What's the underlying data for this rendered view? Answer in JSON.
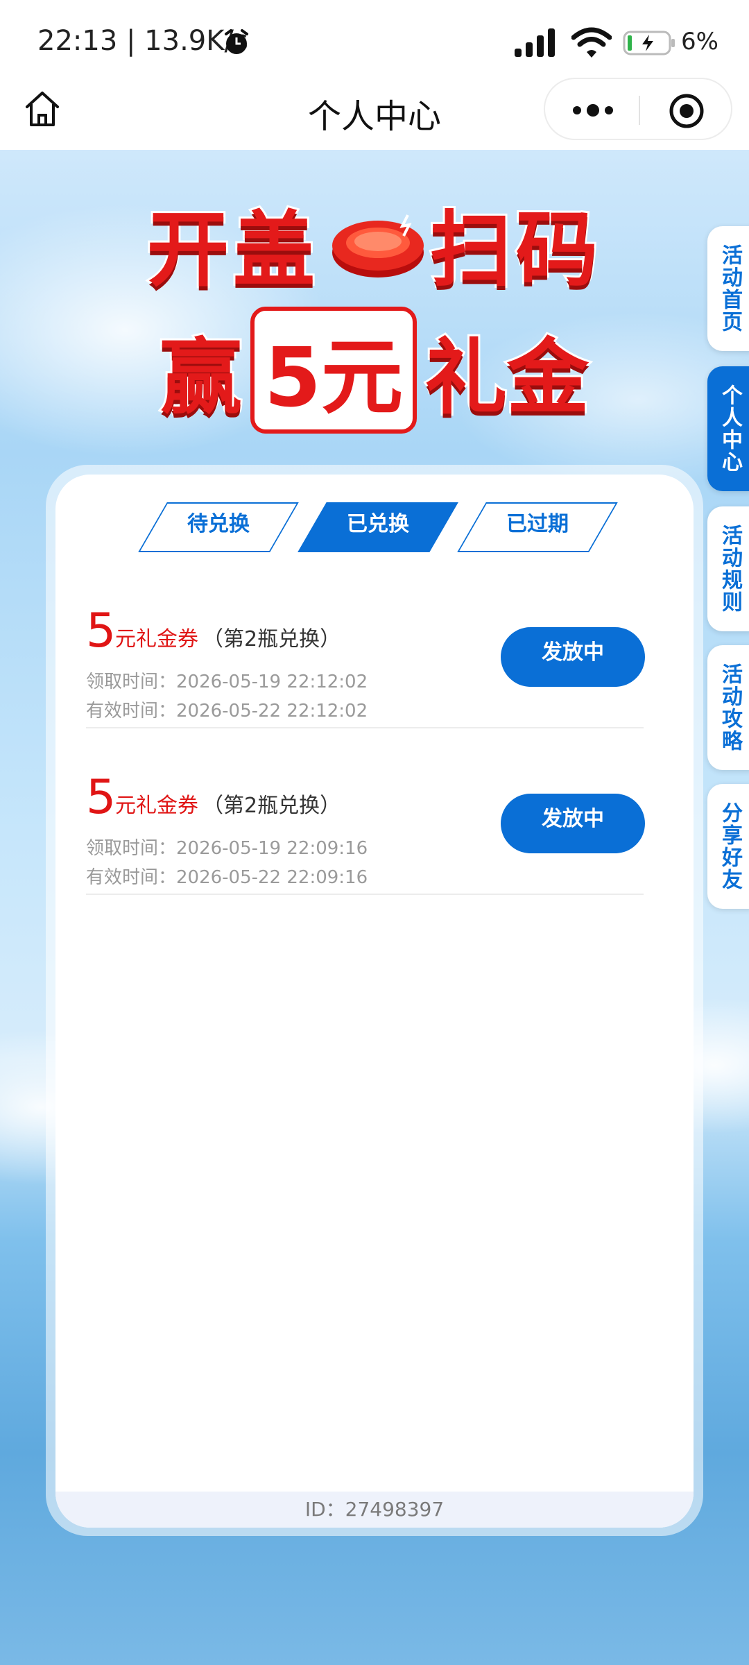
{
  "status_bar": {
    "time": "22:13 | 13.9K/s",
    "battery": "6%",
    "icons": [
      "alarm-icon",
      "signal-icon",
      "wifi-icon",
      "battery-icon"
    ]
  },
  "title_bar": {
    "title": "个人中心",
    "icons": [
      "home-icon",
      "more-icon",
      "target-icon"
    ]
  },
  "banner": {
    "line1_left": "开盖",
    "line1_right": "扫码",
    "line2_prefix": "赢",
    "line2_badge": "5元",
    "line2_suffix": "礼金"
  },
  "side_tabs": [
    "活动首页",
    "个人中心",
    "活动规则",
    "活动攻略",
    "分享好友"
  ],
  "active_side_tab": "个人中心",
  "tabs": [
    {
      "label": "待兑换",
      "active": false
    },
    {
      "label": "已兑换",
      "active": true
    },
    {
      "label": "已过期",
      "active": false
    }
  ],
  "coupons": [
    {
      "amount": "5",
      "unit": "元礼金券",
      "note": "（第2瓶兑换）",
      "received": "领取时间：2026-05-19 22:12:02",
      "valid": "有效时间：2026-05-22 22:12:02",
      "status": "发放中"
    },
    {
      "amount": "5",
      "unit": "元礼金券",
      "note": "（第2瓶兑换）",
      "received": "领取时间：2026-05-19 22:09:16",
      "valid": "有效时间：2026-05-22 22:09:16",
      "status": "发放中"
    }
  ],
  "footer": {
    "id_text": "ID：27498397"
  },
  "colors": {
    "brand_blue": "#0a6fd6",
    "coupon_red": "#e01515",
    "banner_red": "#e31a1a"
  }
}
